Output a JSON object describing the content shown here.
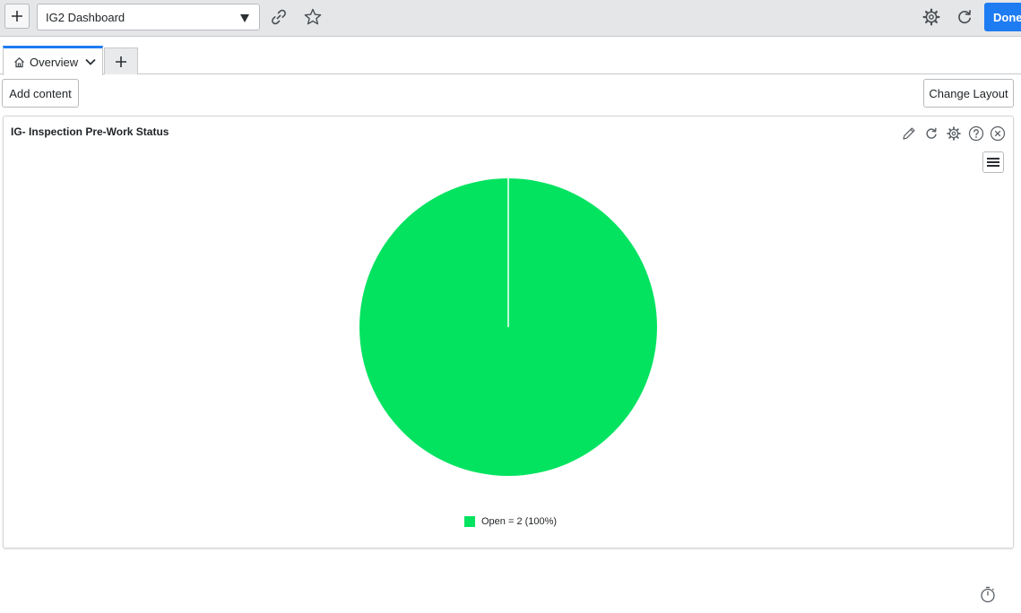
{
  "colors": {
    "accent": "#1e7cf2",
    "pie_open": "#04e360",
    "topbar_bg": "#e5e6e8"
  },
  "topbar": {
    "add_icon": "plus-icon",
    "dashboard_picker": {
      "value": "IG2 Dashboard",
      "icon": "caret-down-icon"
    },
    "share_icon": "link-icon",
    "favorite_icon": "star-icon",
    "settings_icon": "gear-icon",
    "refresh_icon": "refresh-icon",
    "done_label": "Done"
  },
  "tabs": [
    {
      "label": "Overview",
      "icon": "home-icon",
      "active": true,
      "menu_icon": "chevron-down-icon"
    }
  ],
  "add_tab_icon": "plus-icon",
  "toolbar": {
    "add_content_label": "Add content",
    "change_layout_label": "Change Layout"
  },
  "widget": {
    "title": "IG- Inspection Pre-Work Status",
    "actions": [
      "pencil-icon",
      "refresh-icon",
      "gear-icon",
      "help-icon",
      "close-icon"
    ],
    "menu_icon": "hamburger-icon"
  },
  "chart_data": {
    "type": "pie",
    "title": "",
    "slices": [
      {
        "label": "Open",
        "value": 2,
        "percent": 100,
        "color": "#04e360"
      }
    ],
    "legend": {
      "position": "bottom",
      "entries": [
        "Open = 2 (100%)"
      ]
    }
  },
  "footer": {
    "timer_icon": "stopwatch-icon"
  }
}
